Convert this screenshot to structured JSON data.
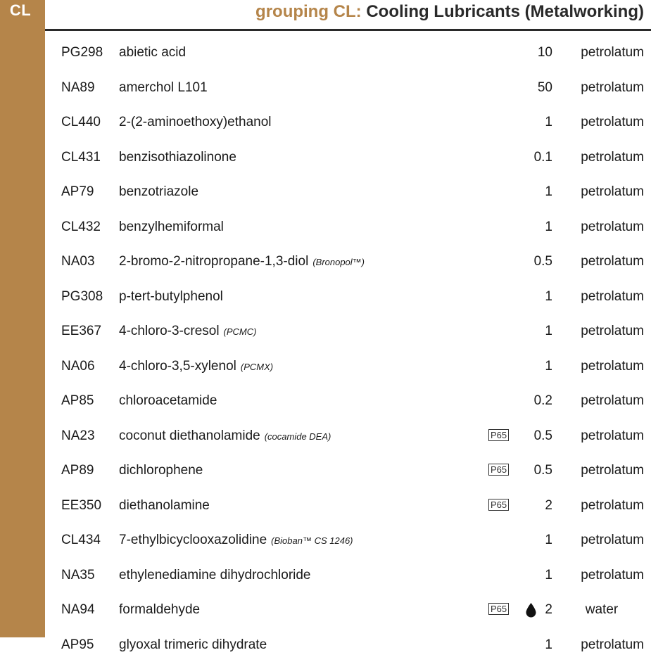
{
  "sidebar": {
    "code": "CL"
  },
  "header": {
    "prefix": "grouping CL:",
    "title": "Cooling Lubricants (Metalworking)"
  },
  "colors": {
    "accent": "#b5854a",
    "text": "#1a1a1a"
  },
  "icons": {
    "p65": "P65",
    "water_drop": "water-drop-icon"
  },
  "rows": [
    {
      "code": "PG298",
      "name": "abietic acid",
      "alt": "",
      "p65": "",
      "conc": "10",
      "vehicle": "petrolatum"
    },
    {
      "code": "NA89",
      "name": "amerchol L101",
      "alt": "",
      "p65": "",
      "conc": "50",
      "vehicle": "petrolatum"
    },
    {
      "code": "CL440",
      "name": "2-(2-aminoethoxy)ethanol",
      "alt": "",
      "p65": "",
      "conc": "1",
      "vehicle": "petrolatum"
    },
    {
      "code": "CL431",
      "name": "benzisothiazolinone",
      "alt": "",
      "p65": "",
      "conc": "0.1",
      "vehicle": "petrolatum"
    },
    {
      "code": "AP79",
      "name": "benzotriazole",
      "alt": "",
      "p65": "",
      "conc": "1",
      "vehicle": "petrolatum"
    },
    {
      "code": "CL432",
      "name": "benzylhemiformal",
      "alt": "",
      "p65": "",
      "conc": "1",
      "vehicle": "petrolatum"
    },
    {
      "code": "NA03",
      "name": "2-bromo-2-nitropropane-1,3-diol",
      "alt": "(Bronopol™)",
      "p65": "",
      "conc": "0.5",
      "vehicle": "petrolatum"
    },
    {
      "code": "PG308",
      "name": "p-tert-butylphenol",
      "alt": "",
      "p65": "",
      "conc": "1",
      "vehicle": "petrolatum"
    },
    {
      "code": "EE367",
      "name": "4-chloro-3-cresol",
      "alt": "(PCMC)",
      "p65": "",
      "conc": "1",
      "vehicle": "petrolatum"
    },
    {
      "code": "NA06",
      "name": "4-chloro-3,5-xylenol",
      "alt": "(PCMX)",
      "p65": "",
      "conc": "1",
      "vehicle": "petrolatum"
    },
    {
      "code": "AP85",
      "name": "chloroacetamide",
      "alt": "",
      "p65": "",
      "conc": "0.2",
      "vehicle": "petrolatum"
    },
    {
      "code": "NA23",
      "name": "coconut diethanolamide",
      "alt": "(cocamide DEA)",
      "p65": "P65",
      "conc": "0.5",
      "vehicle": "petrolatum"
    },
    {
      "code": "AP89",
      "name": "dichlorophene",
      "alt": "",
      "p65": "P65",
      "conc": "0.5",
      "vehicle": "petrolatum"
    },
    {
      "code": "EE350",
      "name": "diethanolamine",
      "alt": "",
      "p65": "P65",
      "conc": "2",
      "vehicle": "petrolatum"
    },
    {
      "code": "CL434",
      "name": "7-ethylbicyclooxazolidine",
      "alt": "(Bioban™ CS 1246)",
      "p65": "",
      "conc": "1",
      "vehicle": "petrolatum"
    },
    {
      "code": "NA35",
      "name": "ethylenediamine dihydrochloride",
      "alt": "",
      "p65": "",
      "conc": "1",
      "vehicle": "petrolatum"
    },
    {
      "code": "NA94",
      "name": "formaldehyde",
      "alt": "",
      "p65": "P65",
      "drop": true,
      "conc": "2",
      "vehicle": "water"
    },
    {
      "code": "AP95",
      "name": "glyoxal trimeric dihydrate",
      "alt": "",
      "p65": "",
      "conc": "1",
      "vehicle": "petrolatum"
    }
  ]
}
